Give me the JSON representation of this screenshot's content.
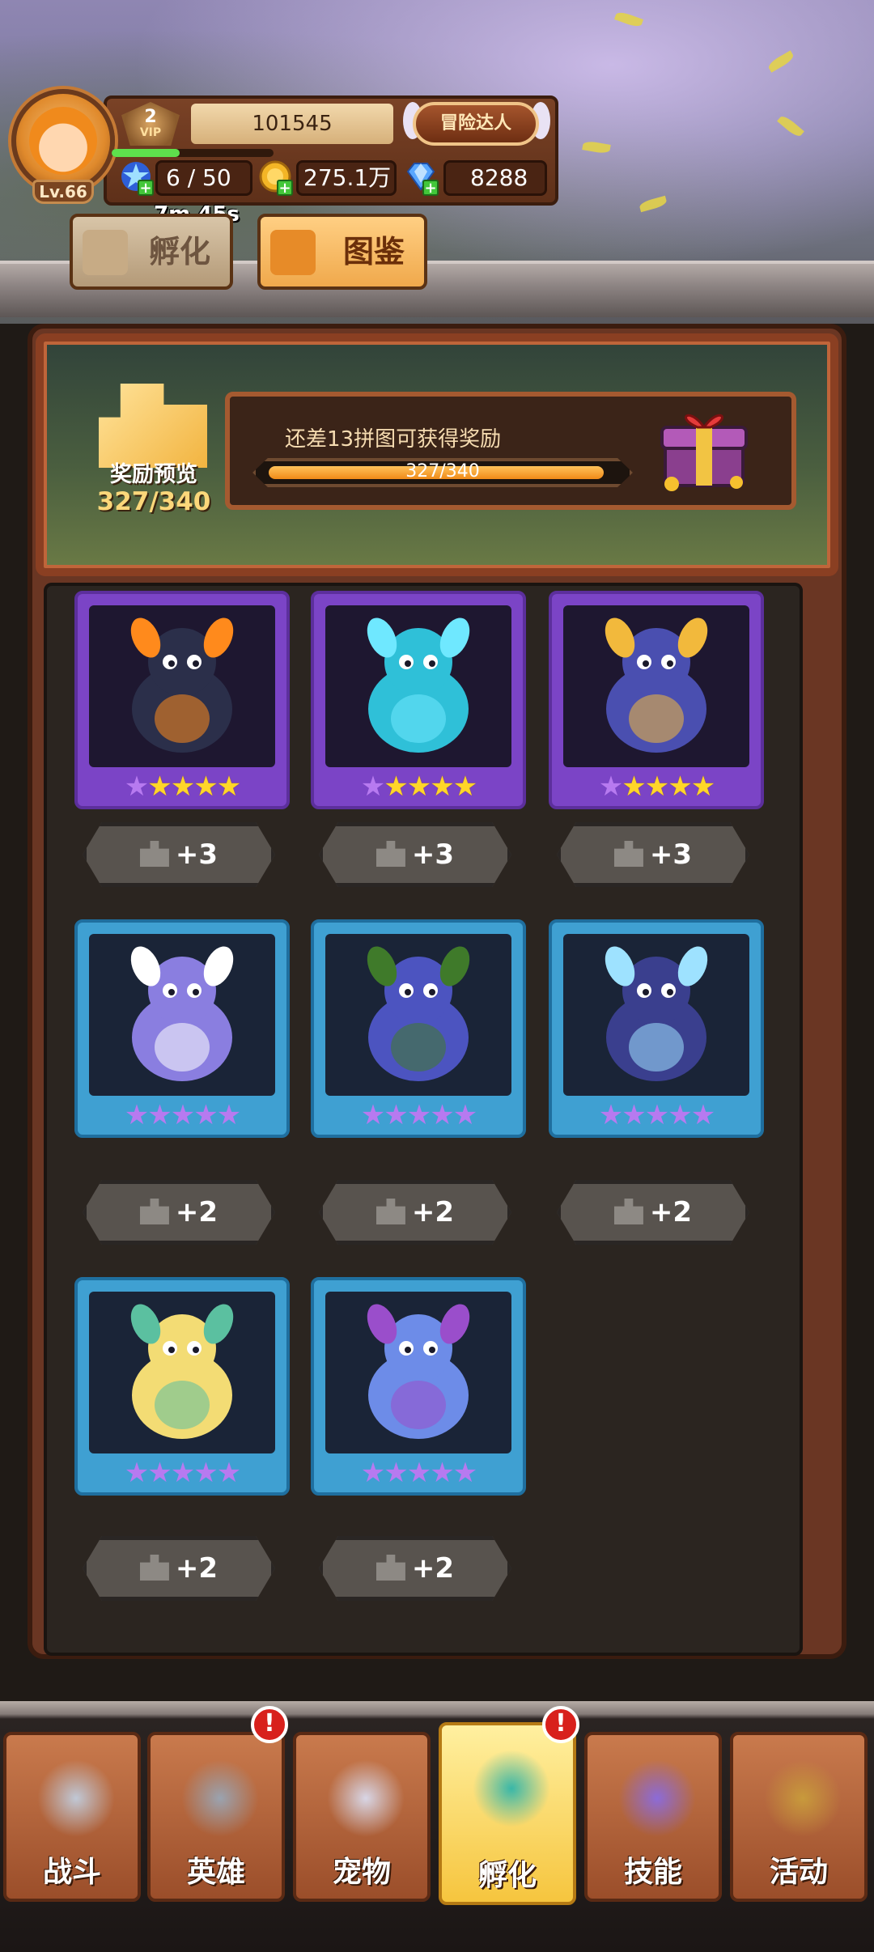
{
  "player": {
    "level": "Lv.66",
    "vip_level": "2",
    "vip_label": "VIP",
    "player_id": "101545",
    "title": "冒险达人",
    "xp_progress": 0.42,
    "energy": "6 / 50",
    "gold": "275.1万",
    "gems": "8288",
    "timer": "7m 45s"
  },
  "tabs": {
    "hatch": "孵化",
    "atlas": "图鉴",
    "active": "atlas"
  },
  "reward": {
    "label": "奖励预览",
    "count": "327/340",
    "hint": "还差13拼图可获得奖励",
    "progress_text": "327/340",
    "progress_value": 327,
    "progress_max": 340
  },
  "pets": [
    {
      "rarity": "purple",
      "stars_gold": 4,
      "stars_total": 5,
      "shard_text": "+3",
      "creature": "fire-dragon",
      "body": "#2b2f4a",
      "accent": "#ff8a1c"
    },
    {
      "rarity": "purple",
      "stars_gold": 4,
      "stars_total": 5,
      "shard_text": "+3",
      "creature": "water-spirit",
      "body": "#2fc0d8",
      "accent": "#6fe8ff"
    },
    {
      "rarity": "purple",
      "stars_gold": 4,
      "stars_total": 5,
      "shard_text": "+3",
      "creature": "manta-knight",
      "body": "#4a4fb0",
      "accent": "#f2b93c"
    },
    {
      "rarity": "blue",
      "stars_gold": 0,
      "stars_total": 5,
      "shard_text": "+2",
      "creature": "wolf-cub",
      "body": "#8a7ee0",
      "accent": "#ffffff"
    },
    {
      "rarity": "blue",
      "stars_gold": 0,
      "stars_total": 5,
      "shard_text": "+2",
      "creature": "leaf-frog",
      "body": "#4c54c0",
      "accent": "#3f7a2a"
    },
    {
      "rarity": "blue",
      "stars_gold": 0,
      "stars_total": 5,
      "shard_text": "+2",
      "creature": "fluffy-bunny",
      "body": "#3a3f8e",
      "accent": "#9ee2ff"
    },
    {
      "rarity": "blue",
      "stars_gold": 0,
      "stars_total": 5,
      "shard_text": "+2",
      "creature": "golden-lion",
      "body": "#f3dc74",
      "accent": "#5bc0a0"
    },
    {
      "rarity": "blue",
      "stars_gold": 0,
      "stars_total": 5,
      "shard_text": "+2",
      "creature": "scarf-mouse",
      "body": "#6d8ce8",
      "accent": "#9a4ecb"
    }
  ],
  "nav": [
    {
      "label": "战斗",
      "icon": "crossed-swords-icon",
      "alert": false
    },
    {
      "label": "英雄",
      "icon": "knight-helmet-icon",
      "alert": true
    },
    {
      "label": "宠物",
      "icon": "winged-pet-icon",
      "alert": false
    },
    {
      "label": "孵化",
      "icon": "egg-icon",
      "alert": true,
      "active": true
    },
    {
      "label": "技能",
      "icon": "spell-book-icon",
      "alert": false
    },
    {
      "label": "活动",
      "icon": "event-scroll-icon",
      "alert": false
    }
  ],
  "alert_symbol": "!",
  "colors": {
    "purple_card": "#7b44c6",
    "blue_card": "#3fa0d2",
    "gold_star": "#ffd629",
    "purple_star": "#b77af0",
    "progress": "#f08a18",
    "nav_active": "#f6c53e"
  }
}
